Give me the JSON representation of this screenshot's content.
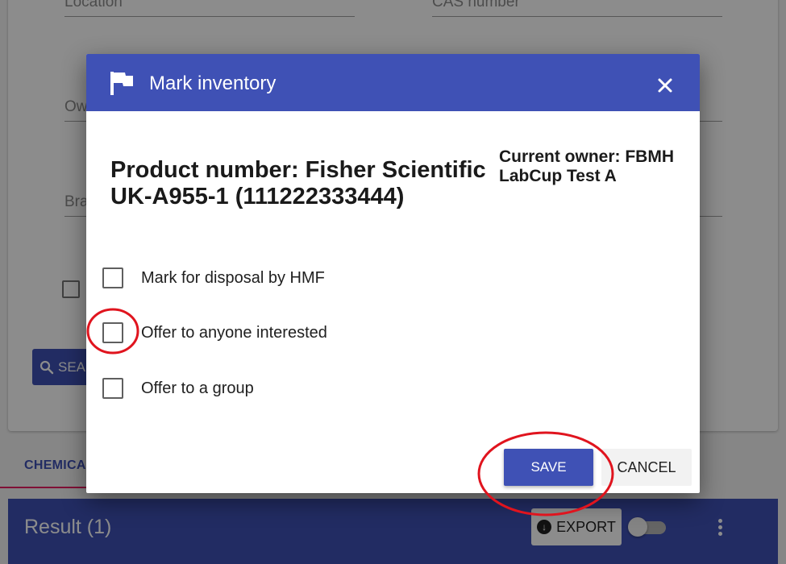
{
  "background": {
    "fields": {
      "location_placeholder": "Location",
      "cas_placeholder": "CAS number",
      "owner_placeholder": "Ow",
      "brand_placeholder": "Bra"
    },
    "search_label": "SEA",
    "tab_label": "CHEMICA",
    "result_title": "Result (1)",
    "export_label": "EXPORT"
  },
  "dialog": {
    "title": "Mark inventory",
    "product_line": "Product number: Fisher Scientific UK-A955-1 (111222333444)",
    "owner_line": "Current owner: FBMH LabCup Test A",
    "options": [
      {
        "label": "Mark for disposal by HMF",
        "checked": false
      },
      {
        "label": "Offer to anyone interested",
        "checked": false
      },
      {
        "label": "Offer to a group",
        "checked": false
      }
    ],
    "save_label": "SAVE",
    "cancel_label": "CANCEL"
  },
  "colors": {
    "primary": "#3f51b5",
    "annotation": "#e0141e",
    "tab_underline": "#e91e63"
  },
  "icons": {
    "header": "flag-icon",
    "close": "close-icon",
    "search": "search-icon",
    "export": "download-circle-icon",
    "menu": "more-vert-icon"
  }
}
